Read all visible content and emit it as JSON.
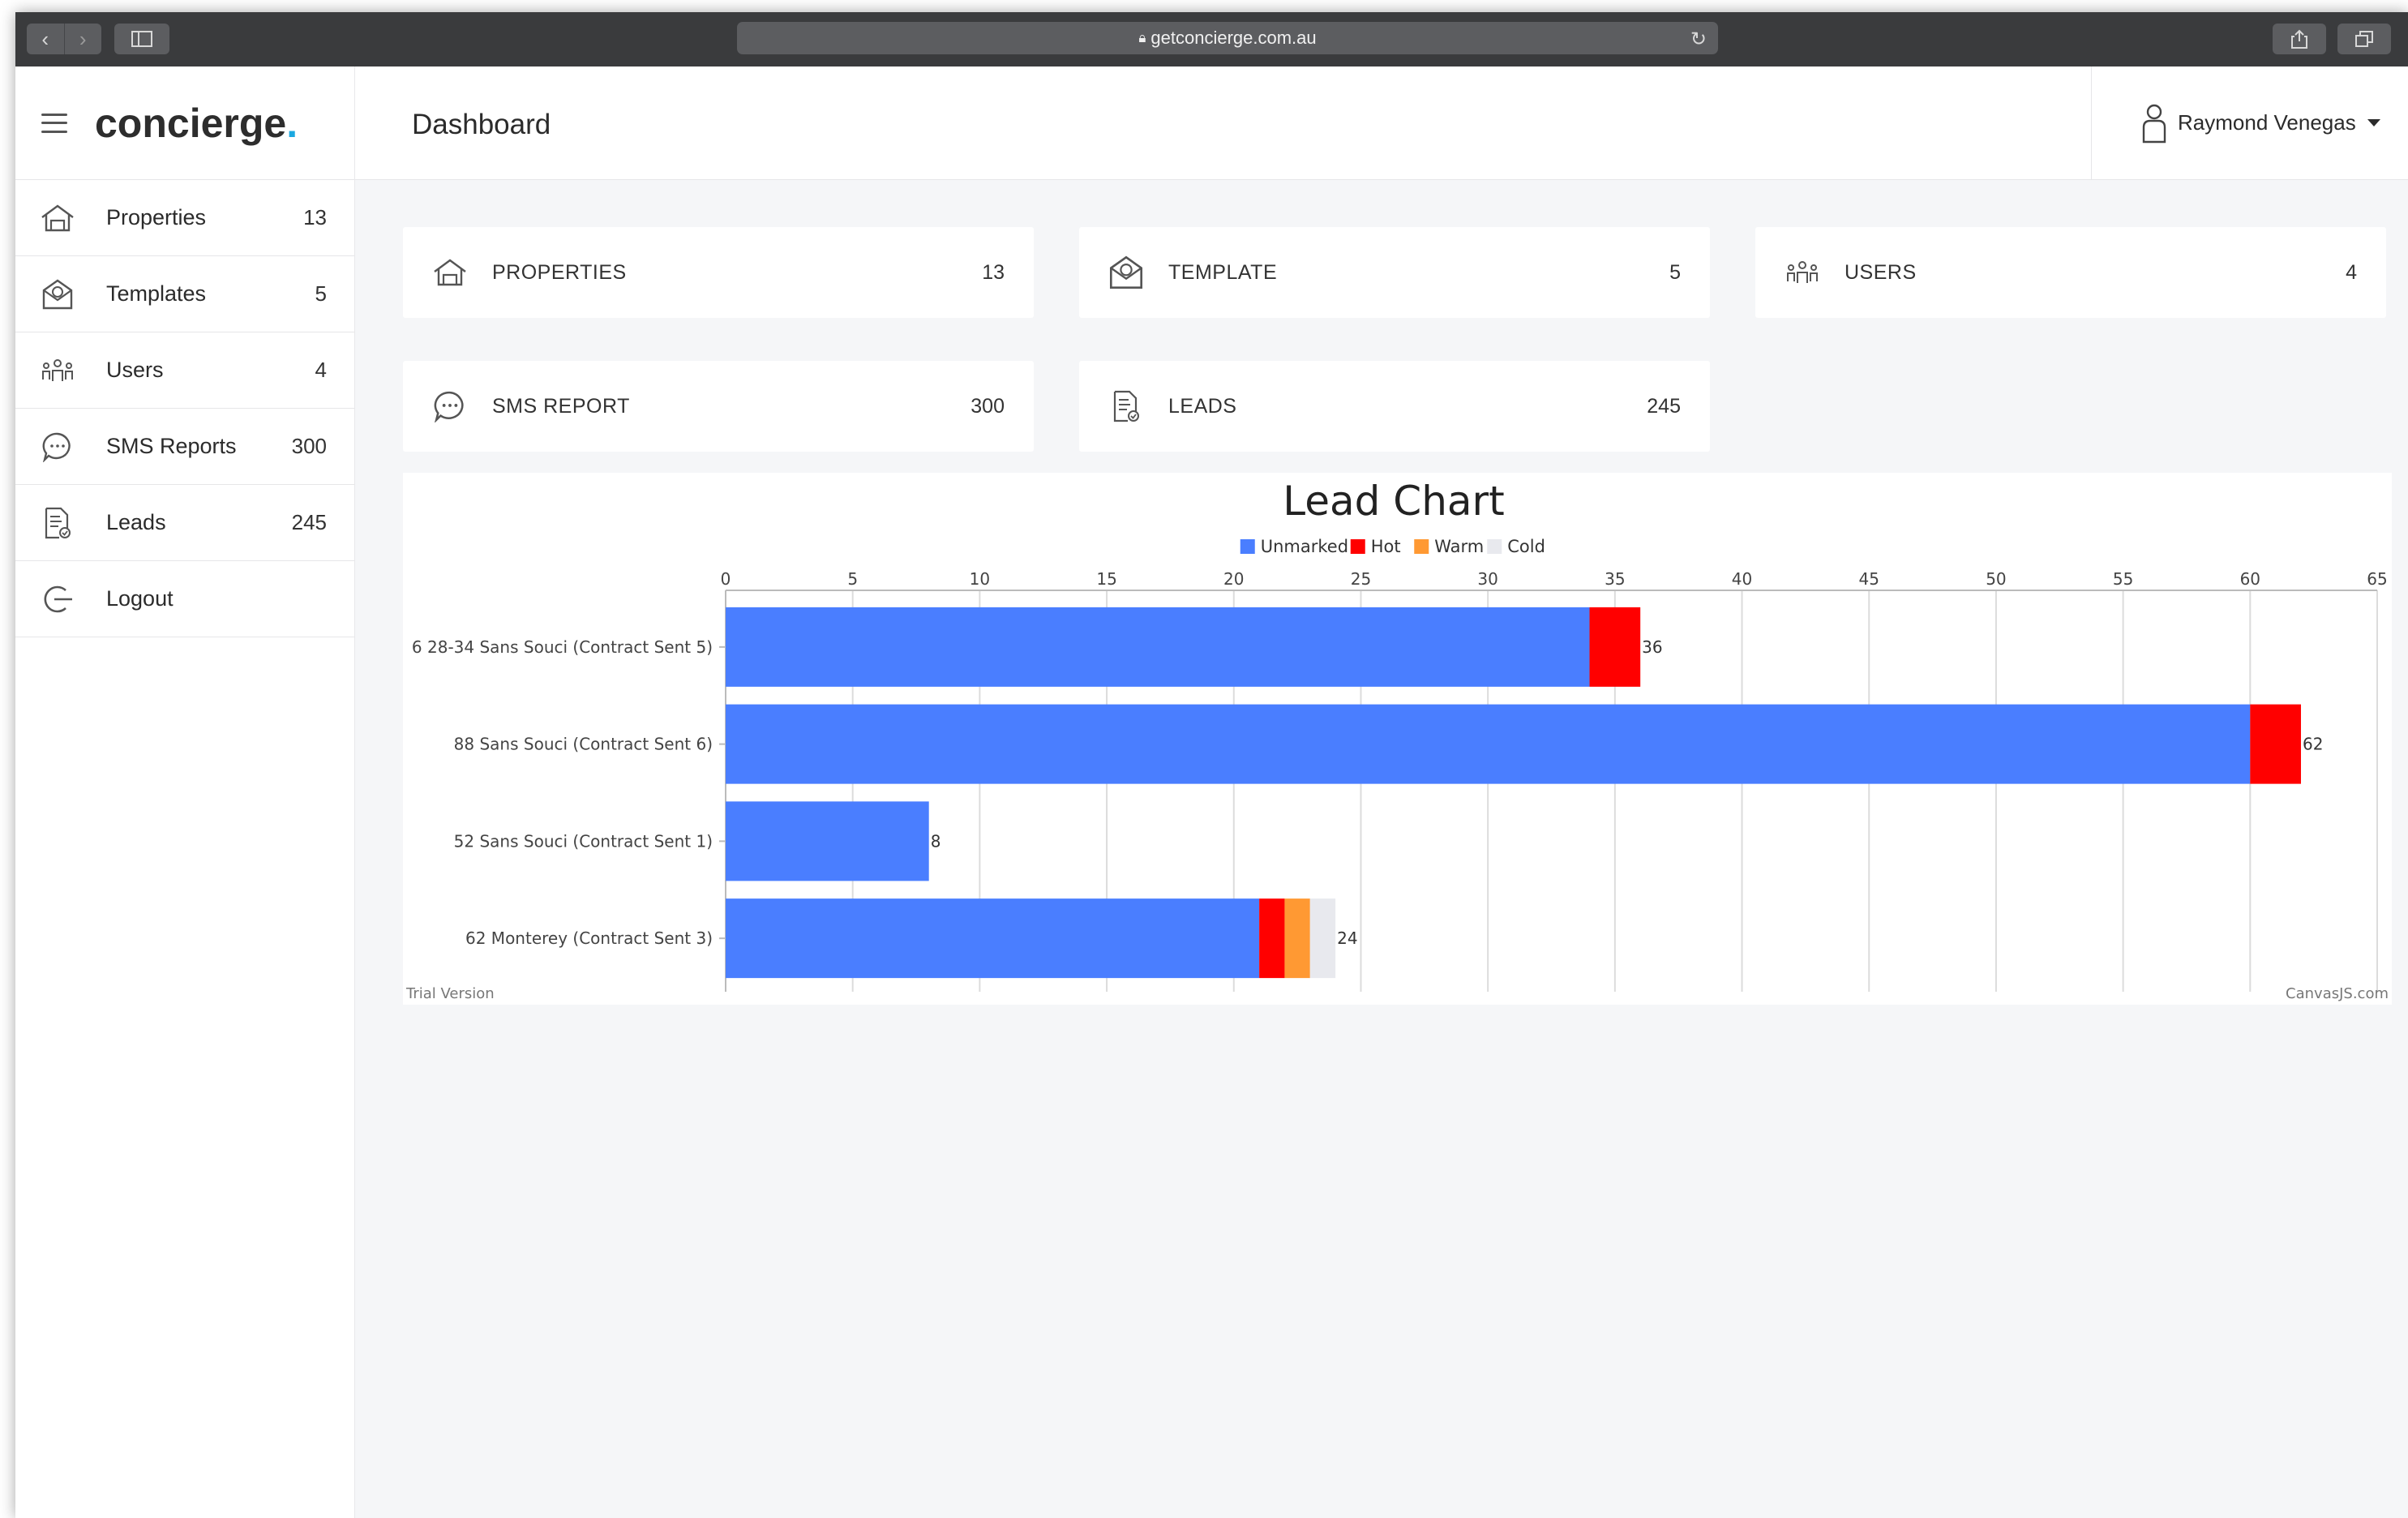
{
  "browser": {
    "url": "getconcierge.com.au"
  },
  "brand": {
    "name": "concierge",
    "dot": "."
  },
  "header": {
    "title": "Dashboard",
    "user_name": "Raymond Venegas"
  },
  "sidebar": {
    "items": [
      {
        "label": "Properties",
        "count": "13",
        "icon": "house-icon"
      },
      {
        "label": "Templates",
        "count": "5",
        "icon": "envelope-icon"
      },
      {
        "label": "Users",
        "count": "4",
        "icon": "users-icon"
      },
      {
        "label": "SMS Reports",
        "count": "300",
        "icon": "chat-icon"
      },
      {
        "label": "Leads",
        "count": "245",
        "icon": "document-icon"
      },
      {
        "label": "Logout",
        "count": "",
        "icon": "logout-icon"
      }
    ]
  },
  "cards": [
    {
      "label": "PROPERTIES",
      "count": "13",
      "icon": "house-icon"
    },
    {
      "label": "TEMPLATE",
      "count": "5",
      "icon": "envelope-icon"
    },
    {
      "label": "USERS",
      "count": "4",
      "icon": "users-icon"
    },
    {
      "label": "SMS REPORT",
      "count": "300",
      "icon": "chat-icon"
    },
    {
      "label": "LEADS",
      "count": "245",
      "icon": "document-icon"
    }
  ],
  "chart_data": {
    "type": "bar",
    "orientation": "horizontal",
    "stacked": true,
    "title": "Lead Chart",
    "categories": [
      "6 28-34 Sans Souci (Contract Sent 5)",
      "88 Sans Souci (Contract Sent 6)",
      "52 Sans Souci (Contract Sent 1)",
      "62 Monterey (Contract Sent 3)"
    ],
    "series": [
      {
        "name": "Unmarked",
        "color": "#4a7eff",
        "values": [
          34,
          60,
          8,
          21
        ]
      },
      {
        "name": "Hot",
        "color": "#ff0000",
        "values": [
          2,
          2,
          0,
          1
        ]
      },
      {
        "name": "Warm",
        "color": "#ff9933",
        "values": [
          0,
          0,
          0,
          1
        ]
      },
      {
        "name": "Cold",
        "color": "#e8e9ee",
        "values": [
          0,
          0,
          0,
          1
        ]
      }
    ],
    "totals": [
      "36",
      "62",
      "8",
      "24"
    ],
    "xlim": [
      0,
      65
    ],
    "x_ticks": [
      "0",
      "5",
      "10",
      "15",
      "20",
      "25",
      "30",
      "35",
      "40",
      "45",
      "50",
      "55",
      "60",
      "65"
    ],
    "legend_position": "top-center",
    "grid": true,
    "footer_left": "Trial Version",
    "footer_right": "CanvasJS.com"
  }
}
